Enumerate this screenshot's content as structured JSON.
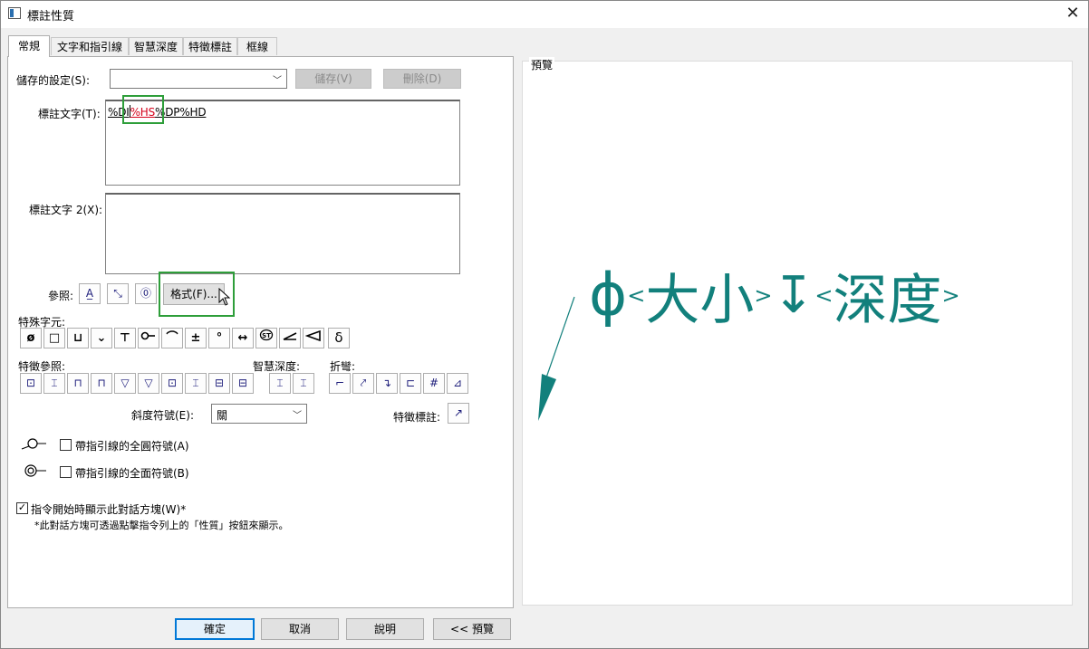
{
  "window": {
    "title": "標註性質",
    "close_icon": "✕"
  },
  "tabs": [
    "常規",
    "文字和指引線",
    "智慧深度",
    "特徵標註",
    "框線"
  ],
  "saved_settings": {
    "label": "儲存的設定(S):",
    "value": "",
    "save_label": "儲存(V)",
    "delete_label": "刪除(D)"
  },
  "callout_text": {
    "label": "標註文字(T):",
    "seg1": "%DI",
    "seg2": "%HS",
    "seg3": "%DP%HD"
  },
  "callout_text2": {
    "label": "標註文字 2(X):",
    "value": ""
  },
  "reference": {
    "label": "參照:",
    "format_label": "格式(F)..."
  },
  "special_chars": {
    "label": "特殊字元:",
    "glyphs": [
      "ø",
      "□",
      "⊔",
      "⌄",
      "⊤",
      "",
      "⌒",
      "±",
      "°",
      "↔",
      "",
      "",
      "",
      "δ"
    ]
  },
  "feature_reference_label": "特徵參照:",
  "smart_depth_label": "智慧深度:",
  "bend_label": "折彎:",
  "slope": {
    "label": "斜度符號(E):",
    "value": "關"
  },
  "feature_callout_label": "特徵標註:",
  "all_around_leader": "帶指引線的全圓符號(A)",
  "all_over_leader": "帶指引線的全面符號(B)",
  "show_dialog": {
    "label": "指令開始時顯示此對話方塊(W)*",
    "checked": true,
    "note": "*此對話方塊可透過點擊指令列上的「性質」按鈕來顯示。"
  },
  "preview": {
    "label": "預覽",
    "phi": "ɸ",
    "lt1": "<",
    "size": "大小",
    "gt1": ">",
    "depth_symbol": "↧",
    "lt2": "<",
    "depth": "深度",
    "gt2": ">",
    "color": "#12807c"
  },
  "buttons": {
    "ok": "確定",
    "cancel": "取消",
    "help": "說明",
    "preview": "<< 預覽"
  }
}
